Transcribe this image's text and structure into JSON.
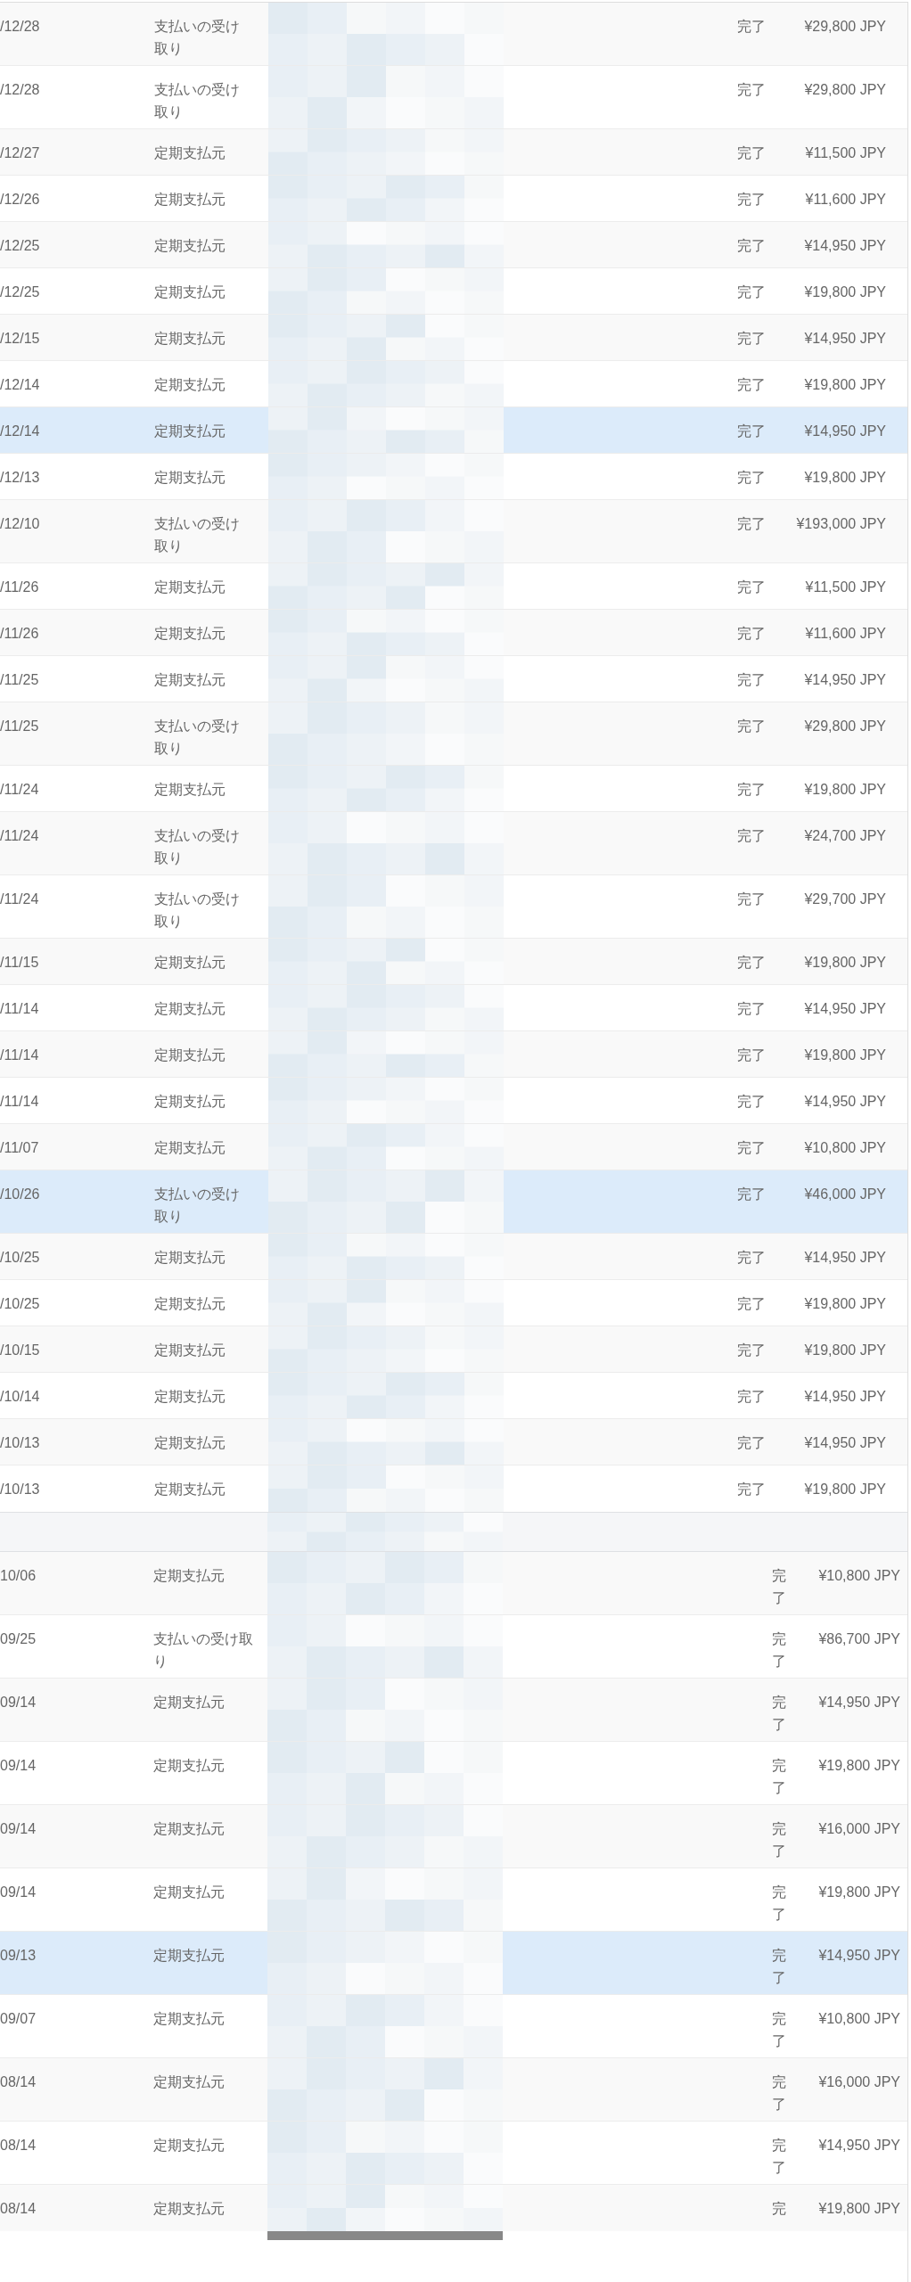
{
  "sections": [
    {
      "kind": "status-inline",
      "rows": [
        {
          "date": "/12/28",
          "type": "支払いの受け取り",
          "status": "完了",
          "amount": "¥29,800 JPY",
          "highlighted": false
        },
        {
          "date": "/12/28",
          "type": "支払いの受け取り",
          "status": "完了",
          "amount": "¥29,800 JPY",
          "highlighted": false
        },
        {
          "date": "/12/27",
          "type": "定期支払元",
          "status": "完了",
          "amount": "¥11,500 JPY",
          "highlighted": false
        },
        {
          "date": "/12/26",
          "type": "定期支払元",
          "status": "完了",
          "amount": "¥11,600 JPY",
          "highlighted": false
        },
        {
          "date": "/12/25",
          "type": "定期支払元",
          "status": "完了",
          "amount": "¥14,950 JPY",
          "highlighted": false
        },
        {
          "date": "/12/25",
          "type": "定期支払元",
          "status": "完了",
          "amount": "¥19,800 JPY",
          "highlighted": false
        },
        {
          "date": "/12/15",
          "type": "定期支払元",
          "status": "完了",
          "amount": "¥14,950 JPY",
          "highlighted": false
        },
        {
          "date": "/12/14",
          "type": "定期支払元",
          "status": "完了",
          "amount": "¥19,800 JPY",
          "highlighted": false
        },
        {
          "date": "/12/14",
          "type": "定期支払元",
          "status": "完了",
          "amount": "¥14,950 JPY",
          "highlighted": true
        },
        {
          "date": "/12/13",
          "type": "定期支払元",
          "status": "完了",
          "amount": "¥19,800 JPY",
          "highlighted": false
        },
        {
          "date": "/12/10",
          "type": "支払いの受け取り",
          "status": "完了",
          "amount": "¥193,000 JPY",
          "highlighted": false
        },
        {
          "date": "/11/26",
          "type": "定期支払元",
          "status": "完了",
          "amount": "¥11,500 JPY",
          "highlighted": false
        },
        {
          "date": "/11/26",
          "type": "定期支払元",
          "status": "完了",
          "amount": "¥11,600 JPY",
          "highlighted": false
        },
        {
          "date": "/11/25",
          "type": "定期支払元",
          "status": "完了",
          "amount": "¥14,950 JPY",
          "highlighted": false
        },
        {
          "date": "/11/25",
          "type": "支払いの受け取り",
          "status": "完了",
          "amount": "¥29,800 JPY",
          "highlighted": false
        },
        {
          "date": "/11/24",
          "type": "定期支払元",
          "status": "完了",
          "amount": "¥19,800 JPY",
          "highlighted": false
        },
        {
          "date": "/11/24",
          "type": "支払いの受け取り",
          "status": "完了",
          "amount": "¥24,700 JPY",
          "highlighted": false
        },
        {
          "date": "/11/24",
          "type": "支払いの受け取り",
          "status": "完了",
          "amount": "¥29,700 JPY",
          "highlighted": false
        },
        {
          "date": "/11/15",
          "type": "定期支払元",
          "status": "完了",
          "amount": "¥19,800 JPY",
          "highlighted": false
        },
        {
          "date": "/11/14",
          "type": "定期支払元",
          "status": "完了",
          "amount": "¥14,950 JPY",
          "highlighted": false
        },
        {
          "date": "/11/14",
          "type": "定期支払元",
          "status": "完了",
          "amount": "¥19,800 JPY",
          "highlighted": false
        },
        {
          "date": "/11/14",
          "type": "定期支払元",
          "status": "完了",
          "amount": "¥14,950 JPY",
          "highlighted": false
        },
        {
          "date": "/11/07",
          "type": "定期支払元",
          "status": "完了",
          "amount": "¥10,800 JPY",
          "highlighted": false
        },
        {
          "date": "/10/26",
          "type": "支払いの受け取り",
          "status": "完了",
          "amount": "¥46,000 JPY",
          "highlighted": true
        },
        {
          "date": "/10/25",
          "type": "定期支払元",
          "status": "完了",
          "amount": "¥14,950 JPY",
          "highlighted": false
        },
        {
          "date": "/10/25",
          "type": "定期支払元",
          "status": "完了",
          "amount": "¥19,800 JPY",
          "highlighted": false
        },
        {
          "date": "/10/15",
          "type": "定期支払元",
          "status": "完了",
          "amount": "¥19,800 JPY",
          "highlighted": false
        },
        {
          "date": "/10/14",
          "type": "定期支払元",
          "status": "完了",
          "amount": "¥14,950 JPY",
          "highlighted": false
        },
        {
          "date": "/10/13",
          "type": "定期支払元",
          "status": "完了",
          "amount": "¥14,950 JPY",
          "highlighted": false
        },
        {
          "date": "/10/13",
          "type": "定期支払元",
          "status": "完了",
          "amount": "¥19,800 JPY",
          "highlighted": false
        }
      ]
    },
    {
      "kind": "status-wrapped",
      "rows": [
        {
          "date": "10/06",
          "type": "定期支払元",
          "status": "完了",
          "amount": "¥10,800 JPY",
          "highlighted": false
        },
        {
          "date": "09/25",
          "type": "支払いの受け取り",
          "status": "完了",
          "amount": "¥86,700 JPY",
          "highlighted": false
        },
        {
          "date": "09/14",
          "type": "定期支払元",
          "status": "完了",
          "amount": "¥14,950 JPY",
          "highlighted": false
        },
        {
          "date": "09/14",
          "type": "定期支払元",
          "status": "完了",
          "amount": "¥19,800 JPY",
          "highlighted": false
        },
        {
          "date": "09/14",
          "type": "定期支払元",
          "status": "完了",
          "amount": "¥16,000 JPY",
          "highlighted": false
        },
        {
          "date": "09/14",
          "type": "定期支払元",
          "status": "完了",
          "amount": "¥19,800 JPY",
          "highlighted": false
        },
        {
          "date": "09/13",
          "type": "定期支払元",
          "status": "完了",
          "amount": "¥14,950 JPY",
          "highlighted": true
        },
        {
          "date": "09/07",
          "type": "定期支払元",
          "status": "完了",
          "amount": "¥10,800 JPY",
          "highlighted": false
        },
        {
          "date": "08/14",
          "type": "定期支払元",
          "status": "完了",
          "amount": "¥16,000 JPY",
          "highlighted": false
        },
        {
          "date": "08/14",
          "type": "定期支払元",
          "status": "完了",
          "amount": "¥14,950 JPY",
          "highlighted": false
        },
        {
          "date": "08/14",
          "type": "定期支払元",
          "status": "完",
          "amount": "¥19,800 JPY",
          "highlighted": false
        }
      ]
    }
  ]
}
